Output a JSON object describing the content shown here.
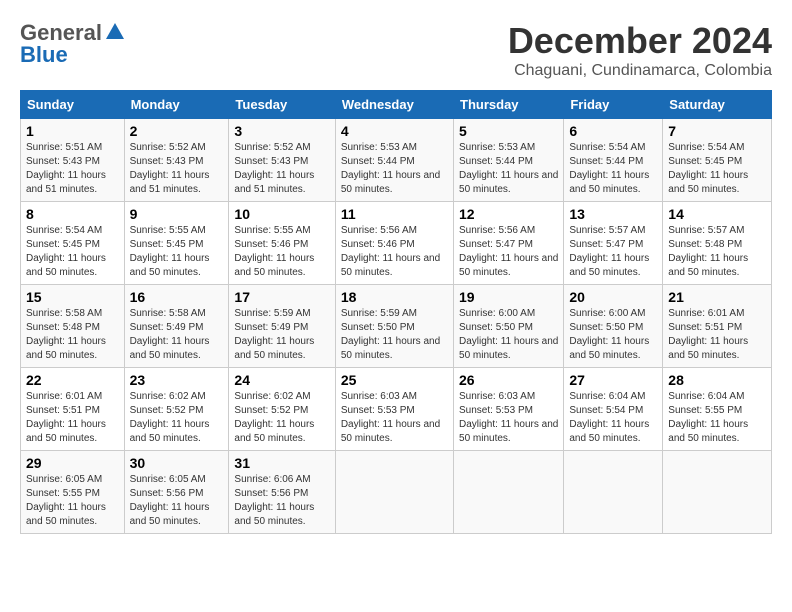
{
  "logo": {
    "general": "General",
    "blue": "Blue"
  },
  "title": "December 2024",
  "subtitle": "Chaguani, Cundinamarca, Colombia",
  "days_of_week": [
    "Sunday",
    "Monday",
    "Tuesday",
    "Wednesday",
    "Thursday",
    "Friday",
    "Saturday"
  ],
  "weeks": [
    [
      {
        "day": "1",
        "sunrise": "5:51 AM",
        "sunset": "5:43 PM",
        "daylight": "11 hours and 51 minutes."
      },
      {
        "day": "2",
        "sunrise": "5:52 AM",
        "sunset": "5:43 PM",
        "daylight": "11 hours and 51 minutes."
      },
      {
        "day": "3",
        "sunrise": "5:52 AM",
        "sunset": "5:43 PM",
        "daylight": "11 hours and 51 minutes."
      },
      {
        "day": "4",
        "sunrise": "5:53 AM",
        "sunset": "5:44 PM",
        "daylight": "11 hours and 50 minutes."
      },
      {
        "day": "5",
        "sunrise": "5:53 AM",
        "sunset": "5:44 PM",
        "daylight": "11 hours and 50 minutes."
      },
      {
        "day": "6",
        "sunrise": "5:54 AM",
        "sunset": "5:44 PM",
        "daylight": "11 hours and 50 minutes."
      },
      {
        "day": "7",
        "sunrise": "5:54 AM",
        "sunset": "5:45 PM",
        "daylight": "11 hours and 50 minutes."
      }
    ],
    [
      {
        "day": "8",
        "sunrise": "5:54 AM",
        "sunset": "5:45 PM",
        "daylight": "11 hours and 50 minutes."
      },
      {
        "day": "9",
        "sunrise": "5:55 AM",
        "sunset": "5:45 PM",
        "daylight": "11 hours and 50 minutes."
      },
      {
        "day": "10",
        "sunrise": "5:55 AM",
        "sunset": "5:46 PM",
        "daylight": "11 hours and 50 minutes."
      },
      {
        "day": "11",
        "sunrise": "5:56 AM",
        "sunset": "5:46 PM",
        "daylight": "11 hours and 50 minutes."
      },
      {
        "day": "12",
        "sunrise": "5:56 AM",
        "sunset": "5:47 PM",
        "daylight": "11 hours and 50 minutes."
      },
      {
        "day": "13",
        "sunrise": "5:57 AM",
        "sunset": "5:47 PM",
        "daylight": "11 hours and 50 minutes."
      },
      {
        "day": "14",
        "sunrise": "5:57 AM",
        "sunset": "5:48 PM",
        "daylight": "11 hours and 50 minutes."
      }
    ],
    [
      {
        "day": "15",
        "sunrise": "5:58 AM",
        "sunset": "5:48 PM",
        "daylight": "11 hours and 50 minutes."
      },
      {
        "day": "16",
        "sunrise": "5:58 AM",
        "sunset": "5:49 PM",
        "daylight": "11 hours and 50 minutes."
      },
      {
        "day": "17",
        "sunrise": "5:59 AM",
        "sunset": "5:49 PM",
        "daylight": "11 hours and 50 minutes."
      },
      {
        "day": "18",
        "sunrise": "5:59 AM",
        "sunset": "5:50 PM",
        "daylight": "11 hours and 50 minutes."
      },
      {
        "day": "19",
        "sunrise": "6:00 AM",
        "sunset": "5:50 PM",
        "daylight": "11 hours and 50 minutes."
      },
      {
        "day": "20",
        "sunrise": "6:00 AM",
        "sunset": "5:50 PM",
        "daylight": "11 hours and 50 minutes."
      },
      {
        "day": "21",
        "sunrise": "6:01 AM",
        "sunset": "5:51 PM",
        "daylight": "11 hours and 50 minutes."
      }
    ],
    [
      {
        "day": "22",
        "sunrise": "6:01 AM",
        "sunset": "5:51 PM",
        "daylight": "11 hours and 50 minutes."
      },
      {
        "day": "23",
        "sunrise": "6:02 AM",
        "sunset": "5:52 PM",
        "daylight": "11 hours and 50 minutes."
      },
      {
        "day": "24",
        "sunrise": "6:02 AM",
        "sunset": "5:52 PM",
        "daylight": "11 hours and 50 minutes."
      },
      {
        "day": "25",
        "sunrise": "6:03 AM",
        "sunset": "5:53 PM",
        "daylight": "11 hours and 50 minutes."
      },
      {
        "day": "26",
        "sunrise": "6:03 AM",
        "sunset": "5:53 PM",
        "daylight": "11 hours and 50 minutes."
      },
      {
        "day": "27",
        "sunrise": "6:04 AM",
        "sunset": "5:54 PM",
        "daylight": "11 hours and 50 minutes."
      },
      {
        "day": "28",
        "sunrise": "6:04 AM",
        "sunset": "5:55 PM",
        "daylight": "11 hours and 50 minutes."
      }
    ],
    [
      {
        "day": "29",
        "sunrise": "6:05 AM",
        "sunset": "5:55 PM",
        "daylight": "11 hours and 50 minutes."
      },
      {
        "day": "30",
        "sunrise": "6:05 AM",
        "sunset": "5:56 PM",
        "daylight": "11 hours and 50 minutes."
      },
      {
        "day": "31",
        "sunrise": "6:06 AM",
        "sunset": "5:56 PM",
        "daylight": "11 hours and 50 minutes."
      },
      null,
      null,
      null,
      null
    ]
  ]
}
